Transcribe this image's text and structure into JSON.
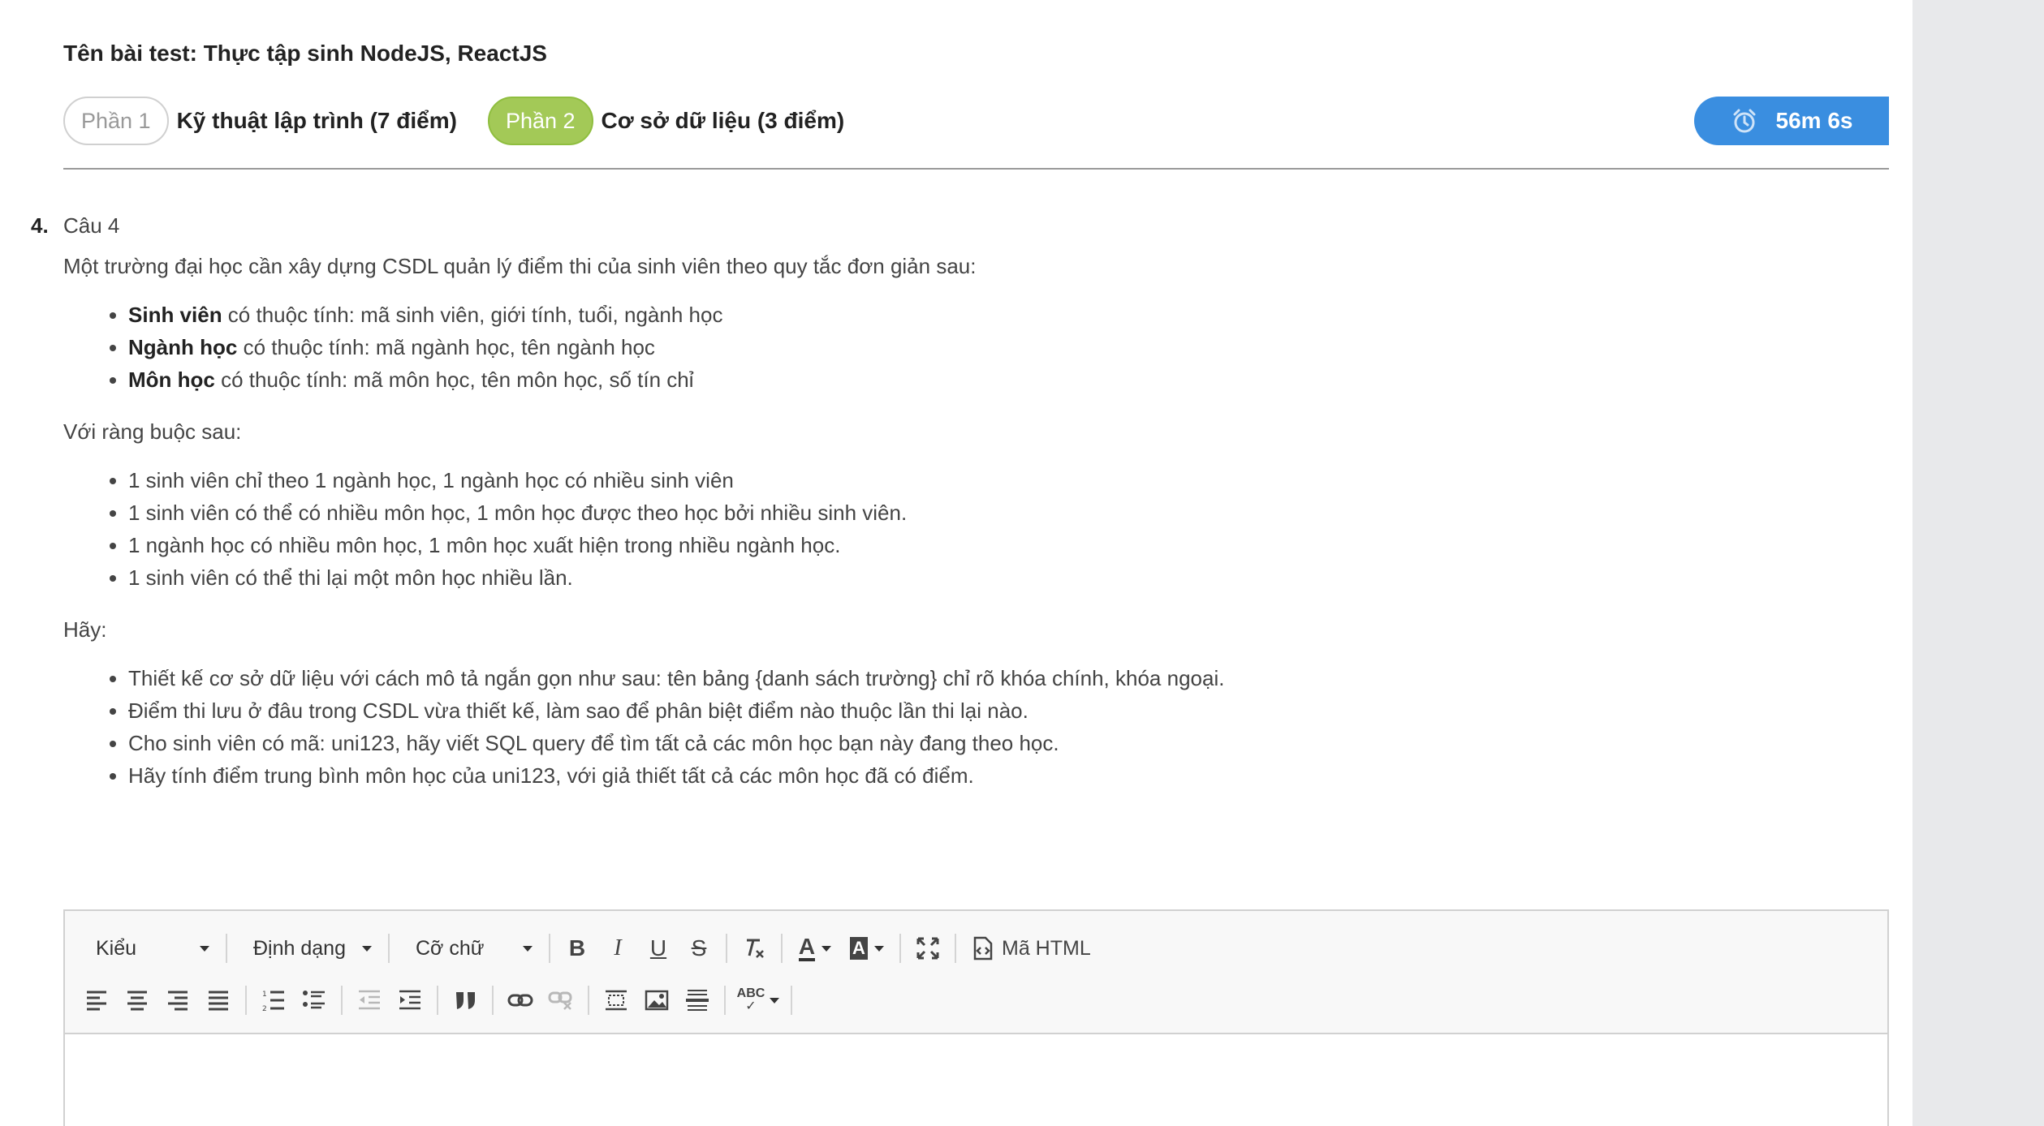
{
  "test": {
    "title": "Tên bài test: Thực tập sinh NodeJS, ReactJS"
  },
  "parts": [
    {
      "pill": "Phần 1",
      "label": "Kỹ thuật lập trình (7 điểm)"
    },
    {
      "pill": "Phần 2",
      "label": "Cơ sở dữ liệu (3 điểm)"
    }
  ],
  "timer": {
    "value": "56m 6s",
    "icon": "alarm-clock-icon"
  },
  "question": {
    "number": "4.",
    "title": "Câu 4",
    "intro": "Một trường đại học cần xây dựng CSDL quản lý điểm thi của sinh viên theo quy tắc đơn giản sau:",
    "entities": [
      {
        "name": "Sinh viên",
        "desc": " có thuộc tính: mã sinh viên, giới tính, tuổi, ngành học"
      },
      {
        "name": "Ngành học",
        "desc": " có thuộc tính: mã ngành học, tên ngành học"
      },
      {
        "name": "Môn học",
        "desc": " có thuộc tính: mã môn học, tên môn học, số tín chỉ"
      }
    ],
    "constraints_label": "Với ràng buộc sau:",
    "constraints": [
      "1 sinh viên chỉ theo 1 ngành học, 1 ngành học có nhiều sinh viên",
      "1 sinh viên có thể có nhiều môn học, 1 môn học được theo học bởi nhiều sinh viên.",
      "1 ngành học có nhiều môn học, 1 môn học xuất hiện trong nhiều ngành học.",
      "1 sinh viên có thể thi lại một môn học nhiều lần."
    ],
    "tasks_label": "Hãy:",
    "tasks": [
      "Thiết kế cơ sở dữ liệu với cách mô tả ngắn gọn như sau: tên bảng {danh sách trường} chỉ rõ khóa chính, khóa ngoại.",
      "Điểm thi lưu ở đâu trong CSDL vừa thiết kế, làm sao để phân biệt điểm nào thuộc lần thi lại nào.",
      "Cho sinh viên có mã: uni123, hãy viết SQL query để tìm tất cả các môn học bạn này đang theo học.",
      "Hãy tính điểm trung bình môn học của uni123, với giả thiết tất cả các môn học đã có điểm."
    ]
  },
  "editor": {
    "style_combo": "Kiểu",
    "format_combo": "Định dạng",
    "size_combo": "Cỡ chữ",
    "source_label": "Mã HTML",
    "bold": "B",
    "italic": "I",
    "underline": "U",
    "strike": "S",
    "font_color": "A",
    "bg_color": "A",
    "spell": "ABC"
  },
  "colors": {
    "accent_timer": "#3a8ee0",
    "part_active": "#a3c957",
    "page_bg": "#ffffff",
    "gutter": "#e8e9eb"
  }
}
